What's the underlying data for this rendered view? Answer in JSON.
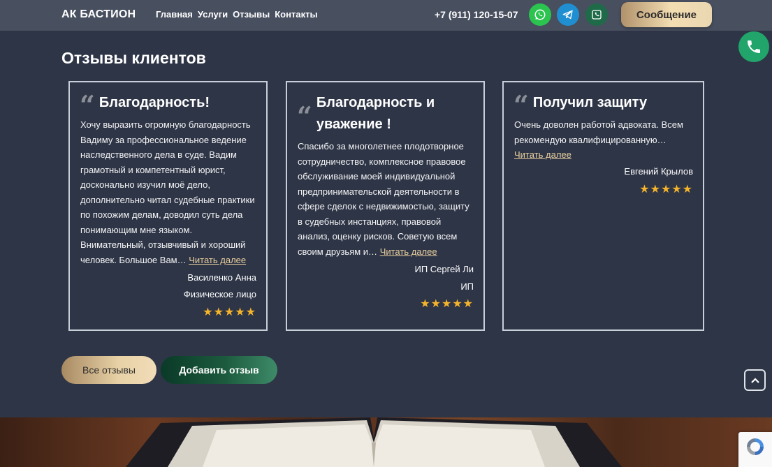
{
  "header": {
    "brand": "АК БАСТИОН",
    "nav": [
      "Главная",
      "Услуги",
      "Отзывы",
      "Контакты"
    ],
    "phone": "+7 (911) 120-15-07",
    "message_button": "Сообщение"
  },
  "section": {
    "title": "Отзывы клиентов"
  },
  "reviews": [
    {
      "title": "Благодарность!",
      "text": "Хочу выразить огромную благодарность Вадиму за профессиональное ведение наследственного дела в суде. Вадим грамотный и компетентный юрист, досконально изучил моё дело, дополнительно читал судебные практики по похожим делам, доводил суть дела понимающим мне языком. Внимательный, отзывчивый и хороший человек. Большое Вам…",
      "more": "Читать далее",
      "author": "Василенко Анна",
      "role": "Физическое лицо",
      "rating": 5
    },
    {
      "title": "Благодарность и уважение !",
      "text": "Спасибо за многолетнее плодотворное сотрудничество, комплексное правовое обслуживание моей индивидуальной предпринимательской деятельности в сфере сделок с недвижимостью, защиту в судебных инстанциях, правовой анализ, оценку рисков. Советую всем своим друзьям и…",
      "more": "Читать далее",
      "author": "ИП Сергей Ли",
      "role": "ИП",
      "rating": 5
    },
    {
      "title": "Получил защиту",
      "text": "Очень доволен работой адвоката. Всем рекомендую квалифицированную…",
      "more": "Читать далее",
      "author": "Евгений Крылов",
      "role": "",
      "rating": 5
    }
  ],
  "buttons": {
    "all_reviews": "Все отзывы",
    "add_review": "Добавить отзыв"
  },
  "icons": {
    "whatsapp": "whatsapp-icon",
    "telegram": "telegram-icon",
    "phone": "phone-icon",
    "call_float": "phone-icon",
    "scroll_top": "chevron-up-icon",
    "quote": "quote-icon",
    "star": "star-icon"
  },
  "colors": {
    "background": "#2e3547",
    "header": "#484f5f",
    "accent_gold": "#e8cf9d",
    "star": "#f5b42a",
    "whatsapp": "#2bc44f",
    "telegram": "#1f8fd1",
    "phone_green": "#1f6b49"
  }
}
